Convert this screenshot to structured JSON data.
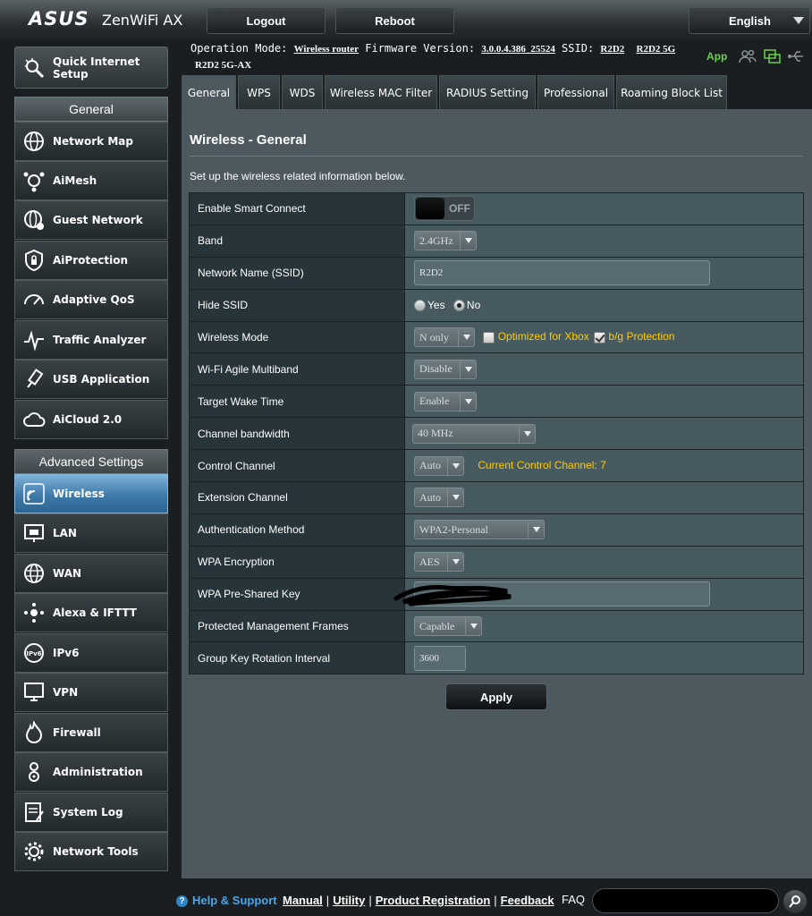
{
  "header": {
    "logo": "ASUS",
    "model": "ZenWiFi AX",
    "logout_label": "Logout",
    "reboot_label": "Reboot",
    "language": "English"
  },
  "status": {
    "operation_mode_label": "Operation Mode:",
    "operation_mode": "Wireless router",
    "firmware_label": "Firmware Version:",
    "firmware": "3.0.0.4.386_25524",
    "ssid_label": "SSID:",
    "ssid_1": "R2D2",
    "ssid_2": "R2D2 5G",
    "ssid_3": "R2D2 5G-AX",
    "app_label": "App"
  },
  "sidebar": {
    "quick_setup": "Quick Internet Setup",
    "general_title": "General",
    "general_items": [
      {
        "label": "Network Map"
      },
      {
        "label": "AiMesh"
      },
      {
        "label": "Guest Network"
      },
      {
        "label": "AiProtection"
      },
      {
        "label": "Adaptive QoS"
      },
      {
        "label": "Traffic Analyzer"
      },
      {
        "label": "USB Application"
      },
      {
        "label": "AiCloud 2.0"
      }
    ],
    "advanced_title": "Advanced Settings",
    "advanced_items": [
      {
        "label": "Wireless"
      },
      {
        "label": "LAN"
      },
      {
        "label": "WAN"
      },
      {
        "label": "Alexa & IFTTT"
      },
      {
        "label": "IPv6"
      },
      {
        "label": "VPN"
      },
      {
        "label": "Firewall"
      },
      {
        "label": "Administration"
      },
      {
        "label": "System Log"
      },
      {
        "label": "Network Tools"
      }
    ]
  },
  "tabs": [
    {
      "label": "General"
    },
    {
      "label": "WPS"
    },
    {
      "label": "WDS"
    },
    {
      "label": "Wireless MAC Filter"
    },
    {
      "label": "RADIUS Setting"
    },
    {
      "label": "Professional"
    },
    {
      "label": "Roaming Block List"
    }
  ],
  "page": {
    "title": "Wireless - General",
    "description": "Set up the wireless related information below.",
    "apply_label": "Apply"
  },
  "settings": {
    "smart_connect": {
      "label": "Enable Smart Connect",
      "value": "OFF"
    },
    "band": {
      "label": "Band",
      "value": "2.4GHz"
    },
    "ssid": {
      "label": "Network Name (SSID)",
      "value": "R2D2"
    },
    "hide_ssid": {
      "label": "Hide SSID",
      "yes": "Yes",
      "no": "No"
    },
    "wireless_mode": {
      "label": "Wireless Mode",
      "value": "N only",
      "xbox": "Optimized for Xbox",
      "bg": "b/g Protection"
    },
    "agile_multiband": {
      "label": "Wi-Fi Agile Multiband",
      "value": "Disable"
    },
    "target_wake_time": {
      "label": "Target Wake Time",
      "value": "Enable"
    },
    "channel_bandwidth": {
      "label": "Channel bandwidth",
      "value": "40 MHz"
    },
    "control_channel": {
      "label": "Control Channel",
      "value": "Auto",
      "current": "Current Control Channel: 7"
    },
    "extension_channel": {
      "label": "Extension Channel",
      "value": "Auto"
    },
    "auth_method": {
      "label": "Authentication Method",
      "value": "WPA2-Personal"
    },
    "wpa_encryption": {
      "label": "WPA Encryption",
      "value": "AES"
    },
    "psk": {
      "label": "WPA Pre-Shared Key"
    },
    "pmf": {
      "label": "Protected Management Frames",
      "value": "Capable"
    },
    "group_key": {
      "label": "Group Key Rotation Interval",
      "value": "3600"
    }
  },
  "footer": {
    "help": "Help & Support",
    "manual": "Manual",
    "utility": "Utility",
    "registration": "Product Registration",
    "feedback": "Feedback",
    "separator": "|",
    "faq": "FAQ"
  }
}
